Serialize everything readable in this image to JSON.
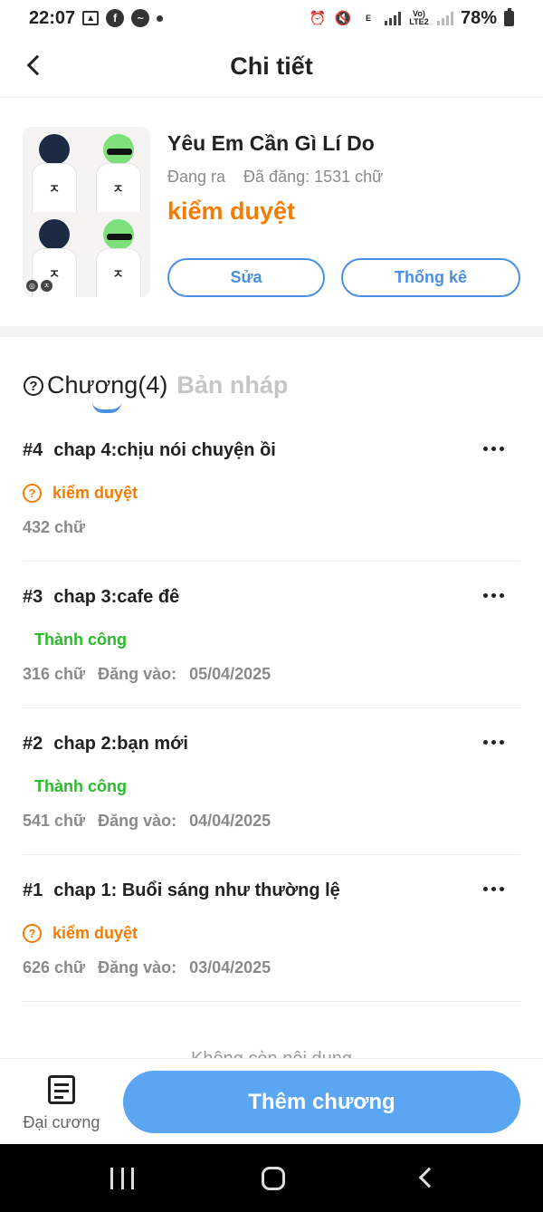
{
  "status_bar": {
    "time": "22:07",
    "signal_label": "Vo) LTE2",
    "e_label": "E",
    "battery": "78%"
  },
  "header": {
    "title": "Chi tiết"
  },
  "story": {
    "title": "Yêu Em Cần Gì Lí Do",
    "state": "Đang ra",
    "published_words": "Đã đăng: 1531 chữ",
    "review_status": "kiểm duyệt",
    "edit_label": "Sửa",
    "stats_label": "Thống kê"
  },
  "tabs": {
    "chapters_label": "Chương(4)",
    "drafts_label": "Bản nháp"
  },
  "chapters": [
    {
      "number": "#4",
      "title": "chap 4:chịu nói chuyện ồi",
      "status": "kiểm duyệt",
      "status_type": "review",
      "words": "432 chữ",
      "posted_label": "",
      "posted_date": ""
    },
    {
      "number": "#3",
      "title": "chap 3:cafe đê",
      "status": "Thành công",
      "status_type": "success",
      "words": "316 chữ",
      "posted_label": "Đăng vào:",
      "posted_date": "05/04/2025"
    },
    {
      "number": "#2",
      "title": "chap 2:bạn mới",
      "status": "Thành công",
      "status_type": "success",
      "words": "541 chữ",
      "posted_label": "Đăng vào:",
      "posted_date": "04/04/2025"
    },
    {
      "number": "#1",
      "title": "chap 1: Buổi sáng như thường lệ",
      "status": "kiểm duyệt",
      "status_type": "review",
      "words": "626 chữ",
      "posted_label": "Đăng vào:",
      "posted_date": "03/04/2025"
    }
  ],
  "list_end": "Không còn nội dung",
  "bottom_bar": {
    "outline_label": "Đại cương",
    "add_chapter_label": "Thêm chương"
  },
  "colors": {
    "accent": "#4a90e2",
    "add_button": "#5aa6f2",
    "review": "#f57c00",
    "success": "#2db82d"
  }
}
